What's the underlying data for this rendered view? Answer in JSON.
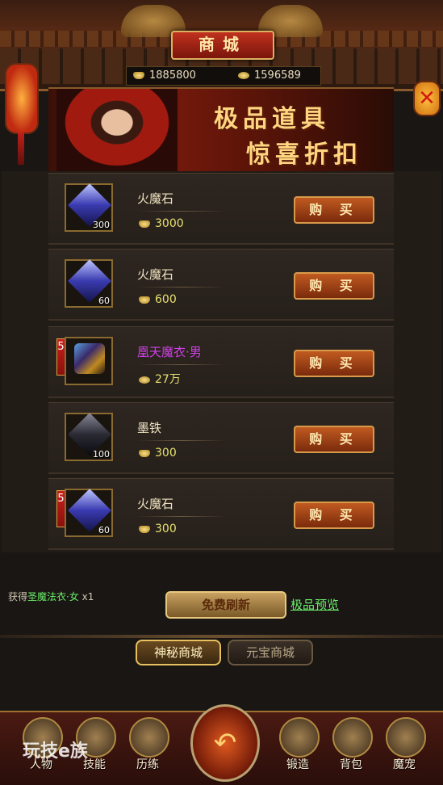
{
  "title": "商城",
  "currency": {
    "ingot": "1885800",
    "coin": "1596589"
  },
  "banner": {
    "line1": "极品道具",
    "line2": "惊喜折扣"
  },
  "items": [
    {
      "name": "火魔石",
      "qty": "300",
      "price": "3000",
      "price_icon": "ingot-icon",
      "discount": "",
      "buy": "购 买"
    },
    {
      "name": "火魔石",
      "qty": "60",
      "price": "600",
      "price_icon": "ingot-icon",
      "discount": "",
      "buy": "购 买"
    },
    {
      "name": "凰天魔衣·男",
      "qty": "",
      "price": "27万",
      "price_icon": "coin-icon",
      "discount": "5折",
      "buy": "购 买"
    },
    {
      "name": "墨铁",
      "qty": "100",
      "price": "300",
      "price_icon": "ingot-icon",
      "discount": "",
      "buy": "购 买"
    },
    {
      "name": "火魔石",
      "qty": "60",
      "price": "300",
      "price_icon": "ingot-icon",
      "discount": "5折",
      "buy": "购 买"
    }
  ],
  "notice": {
    "prefix": "获得",
    "item": "圣魔法衣·女",
    "count": "x1"
  },
  "refresh_label": "免费刷新",
  "preview_label": "极品预览",
  "tabs": {
    "mystic": "神秘商城",
    "yuanbao": "元宝商城"
  },
  "nav": {
    "character": "人物",
    "skills": "技能",
    "training": "历练",
    "forge": "锻造",
    "bag": "背包",
    "pet": "魔宠"
  },
  "watermark": "玩技e族"
}
